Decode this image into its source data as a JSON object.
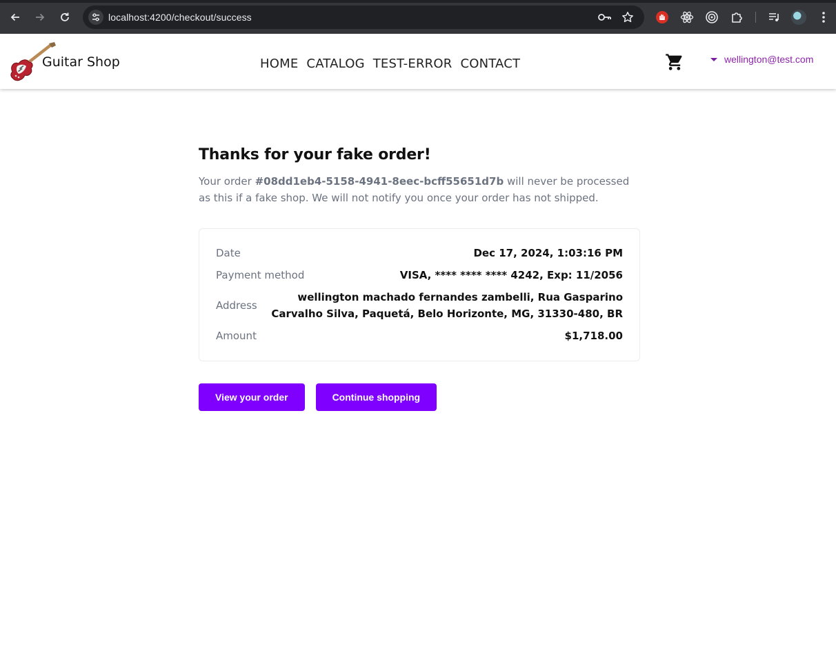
{
  "browser": {
    "url": "localhost:4200/checkout/success"
  },
  "header": {
    "brand": "Guitar Shop",
    "nav": [
      "HOME",
      "CATALOG",
      "TEST-ERROR",
      "CONTACT"
    ],
    "user_email": "wellington@test.com"
  },
  "success": {
    "title": "Thanks for your fake order!",
    "message_prefix": "Your order ",
    "order_id": "#08dd1eb4-5158-4941-8eec-bcff55651d7b",
    "message_suffix": " will never be processed as this if a fake shop. We will not notify you once your order has not shipped."
  },
  "summary": {
    "date_label": "Date",
    "date_value": "Dec 17, 2024, 1:03:16 PM",
    "payment_label": "Payment method",
    "payment_value": "VISA, **** **** **** 4242, Exp: 11/2056",
    "address_label": "Address",
    "address_value": "wellington machado fernandes zambelli, Rua Gasparino Carvalho Silva, Paquetá, Belo Horizonte, MG, 31330-480, BR",
    "amount_label": "Amount",
    "amount_value": "$1,718.00"
  },
  "actions": {
    "view_order": "View your order",
    "continue_shopping": "Continue shopping"
  },
  "colors": {
    "accent": "#7f00ff",
    "user_link": "#8e24aa"
  }
}
